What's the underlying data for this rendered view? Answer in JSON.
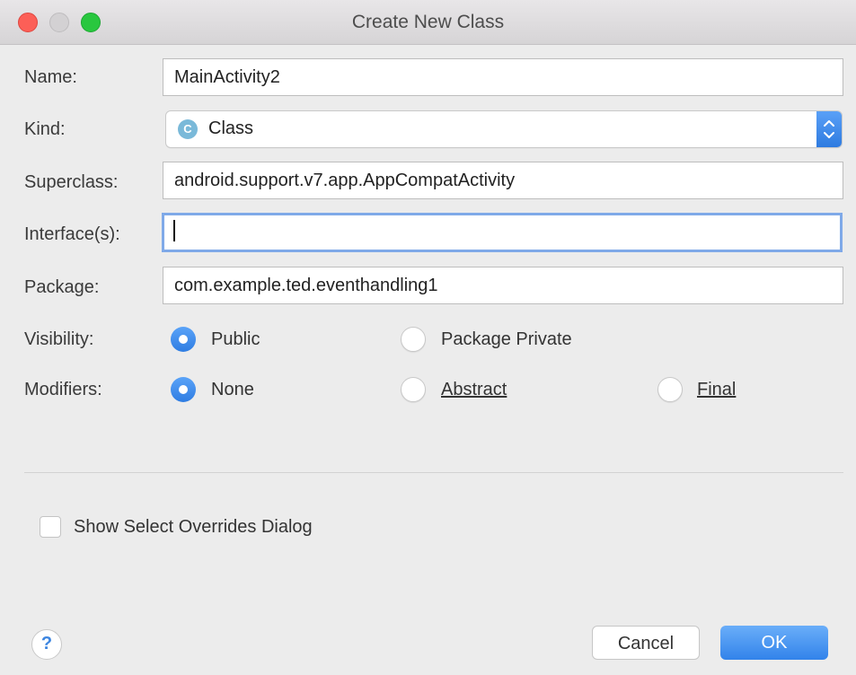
{
  "window": {
    "title": "Create New Class"
  },
  "form": {
    "name_label": "Name:",
    "name_value": "MainActivity2",
    "kind_label": "Kind:",
    "kind_icon_letter": "C",
    "kind_value": "Class",
    "superclass_label": "Superclass:",
    "superclass_value": "android.support.v7.app.AppCompatActivity",
    "interfaces_label": "Interface(s):",
    "interfaces_value": "",
    "package_label": "Package:",
    "package_value": "com.example.ted.eventhandling1"
  },
  "visibility": {
    "label": "Visibility:",
    "options": [
      {
        "label": "Public",
        "selected": true
      },
      {
        "label": "Package Private",
        "selected": false
      }
    ]
  },
  "modifiers": {
    "label": "Modifiers:",
    "options": [
      {
        "label": "None",
        "selected": true
      },
      {
        "label": "Abstract",
        "selected": false
      },
      {
        "label": "Final",
        "selected": false
      }
    ]
  },
  "overrides": {
    "label": "Show Select Overrides Dialog",
    "checked": false
  },
  "footer": {
    "help_symbol": "?",
    "cancel_label": "Cancel",
    "ok_label": "OK"
  },
  "colors": {
    "accent": "#3283ea",
    "close": "#fc5f57",
    "maximize": "#29c73f"
  }
}
